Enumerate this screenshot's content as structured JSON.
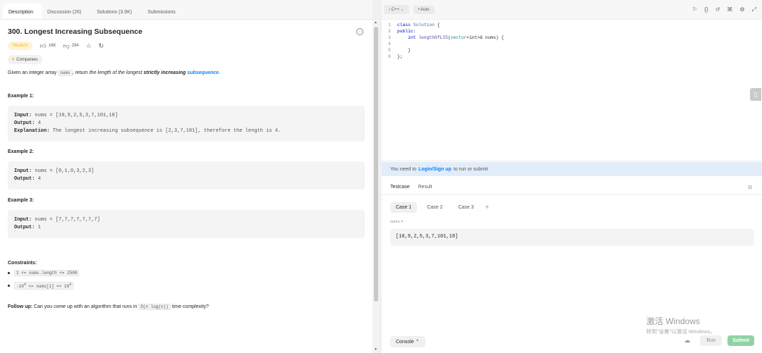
{
  "tabs": [
    "Description",
    "Discussion (26)",
    "Solutions (3.9K)",
    "Submissions"
  ],
  "problem": {
    "title": "300. Longest Increasing Subsequence",
    "difficulty": "Medium",
    "likes": "16K",
    "dislikes": "294",
    "companies_label": "Companies",
    "desc_pre": "Given an integer array ",
    "desc_code": "nums",
    "desc_mid": ", return ",
    "desc_em": "the length of the longest ",
    "desc_bold": "strictly increasing",
    "desc_link": "subsequence",
    "desc_end": "."
  },
  "examples": [
    {
      "title": "Example 1:",
      "input_label": "Input:",
      "input": " nums = [10,9,2,5,3,7,101,18]",
      "output_label": "Output:",
      "output": " 4",
      "explanation_label": "Explanation:",
      "explanation": " The longest increasing subsequence is [2,3,7,101], therefore the length is 4."
    },
    {
      "title": "Example 2:",
      "input_label": "Input:",
      "input": " nums = [0,1,0,3,2,3]",
      "output_label": "Output:",
      "output": " 4"
    },
    {
      "title": "Example 3:",
      "input_label": "Input:",
      "input": " nums = [7,7,7,7,7,7,7]",
      "output_label": "Output:",
      "output": " 1"
    }
  ],
  "constraints": {
    "title": "Constraints:",
    "items": [
      "1 <= nums.length <= 2500",
      "-10^4 <= nums[i] <= 10^4"
    ],
    "c1": "1 <= nums.length <= 2500",
    "c2_a": "-10",
    "c2_exp": "4",
    "c2_b": " <= nums[i] <= 10",
    "c2_exp2": "4"
  },
  "followup": {
    "label": "Follow up:",
    "pre": " Can you come up with an algorithm that runs in ",
    "code": "O(n log(n))",
    "post": " time complexity?"
  },
  "editor": {
    "language": "C++",
    "mode": "Auto",
    "lines": [
      {
        "n": "1",
        "a": "class",
        "b": " Solution {"
      },
      {
        "n": "2",
        "a": "public:",
        "b": ""
      },
      {
        "n": "3",
        "a": "    int",
        "b": " lengthOfLIS(vector<int>& nums) {"
      },
      {
        "n": "4",
        "a": "",
        "b": ""
      },
      {
        "n": "5",
        "a": "",
        "b": "    }"
      },
      {
        "n": "6",
        "a": "",
        "b": "};"
      }
    ],
    "l1_kw": "class",
    "l1_ty": "Solution",
    "l1_rest": " {",
    "l2_kw": "public:",
    "l3_kw": "int",
    "l3_fn": "lengthOfLIS",
    "l3_p": "(",
    "l3_ty": "vector",
    "l3_rest": "<int>& nums) {",
    "l5": "    }",
    "l6": "};"
  },
  "login": {
    "pre": "You need to",
    "link": "Login/Sign up",
    "post": "to run or submit"
  },
  "testpanel": {
    "tabs": [
      "Testcase",
      "Result"
    ],
    "cases": [
      "Case 1",
      "Case 2",
      "Case 3"
    ],
    "param_label": "nums =",
    "param_value": "[10,9,2,5,3,7,101,18]"
  },
  "watermark": {
    "line1": "激活 Windows",
    "line2": "转到\"设置\"以激活 Windows。"
  },
  "bottom": {
    "console": "Console",
    "run": "Run",
    "submit": "Submit"
  },
  "colors": {
    "accent_link": "#0a84ff",
    "submit": "#8fd3a4",
    "medium": "#ffb800"
  }
}
